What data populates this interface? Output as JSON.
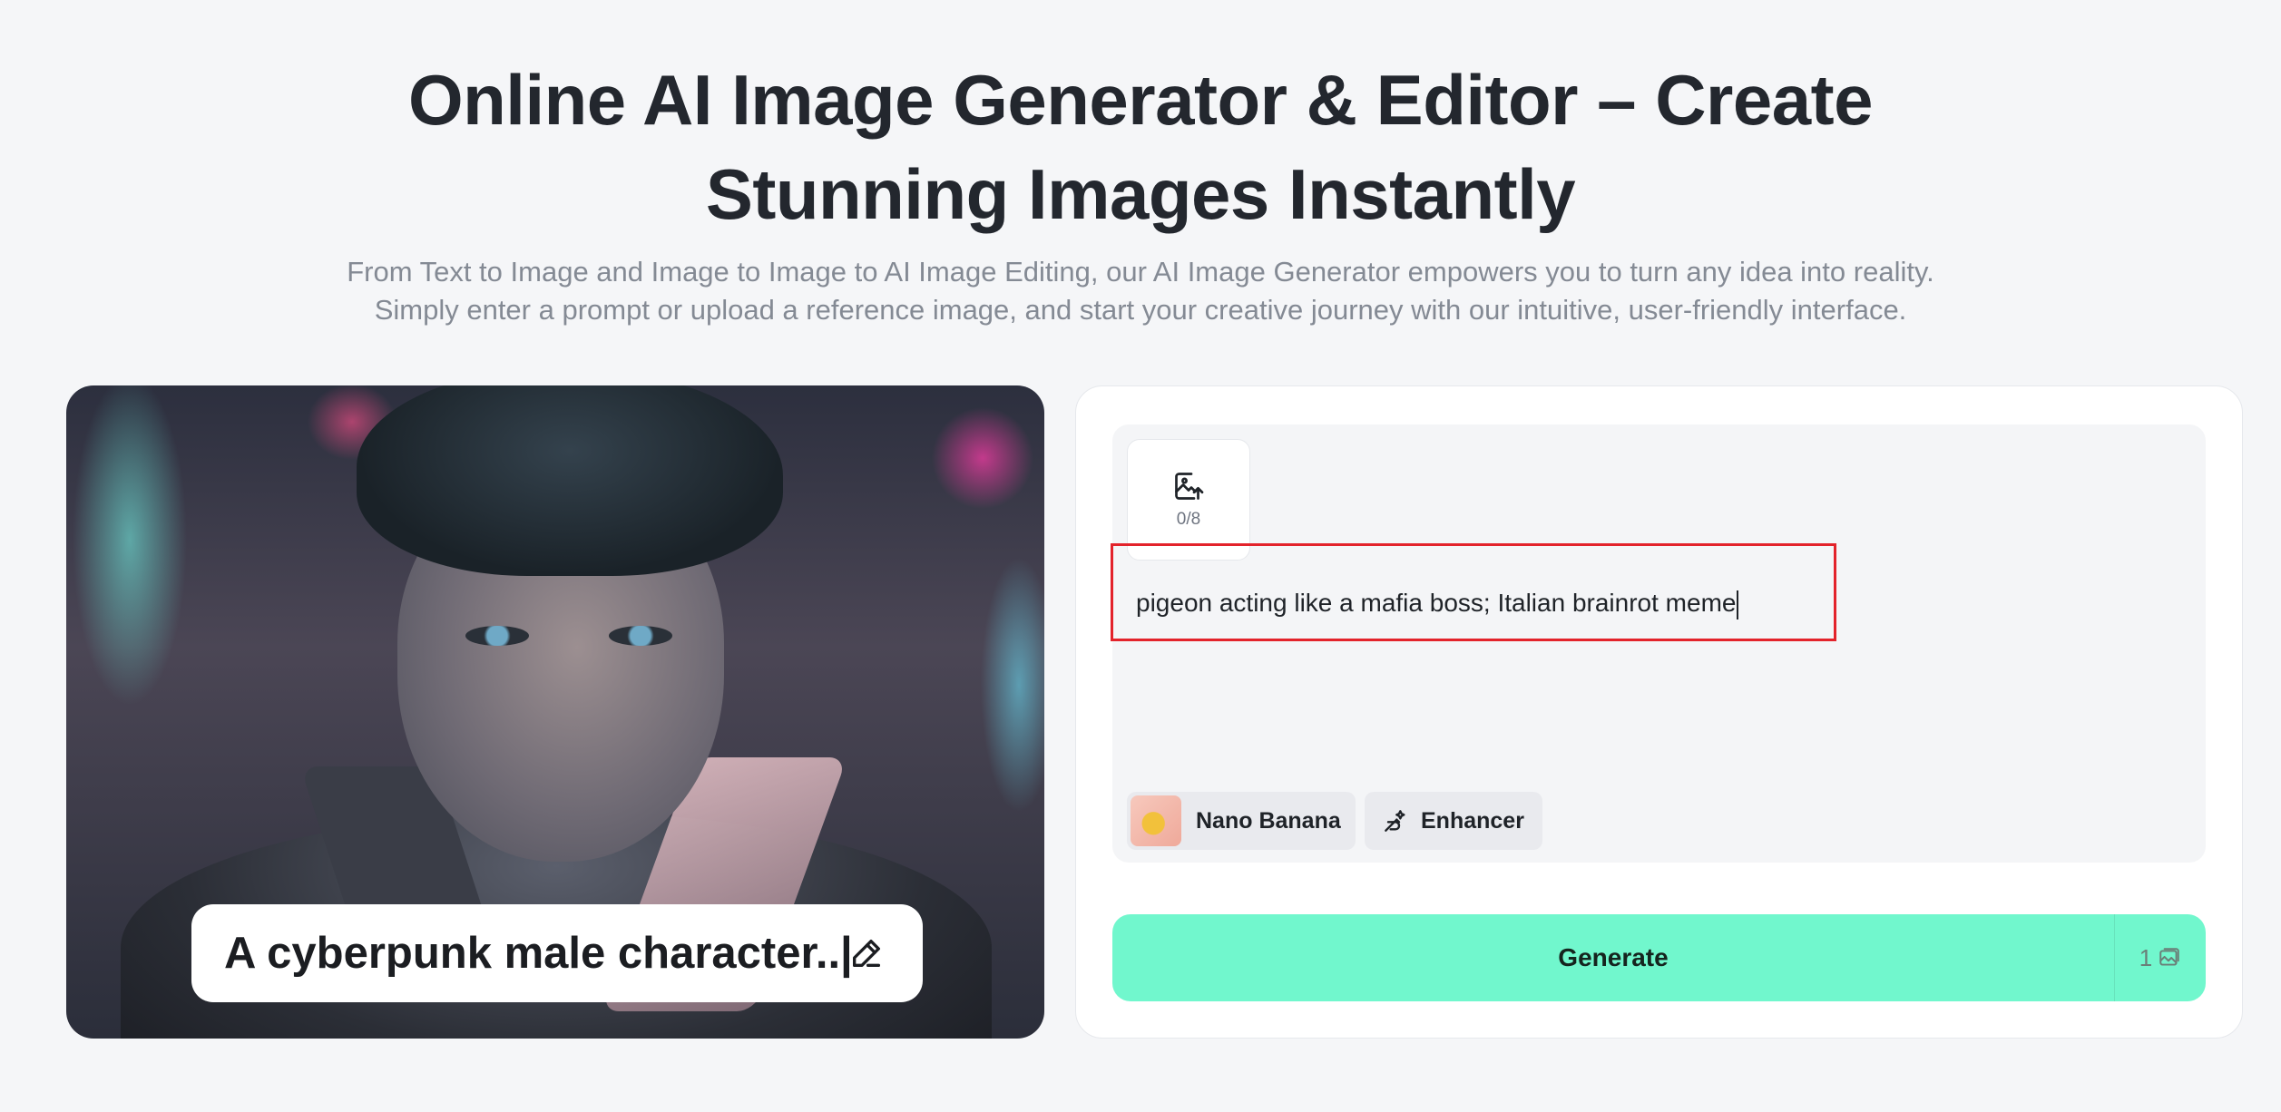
{
  "hero": {
    "title_line1": "Online AI Image Generator & Editor – Create",
    "title_line2": "Stunning Images Instantly",
    "subtitle_line1": "From Text to Image and Image to Image to AI Image Editing, our AI Image Generator empowers you to turn any idea into reality.",
    "subtitle_line2": "Simply enter a prompt or upload a reference image, and start your creative journey with our intuitive, user-friendly interface."
  },
  "showcase": {
    "caption": "A cyberpunk male character..|",
    "caption_icon": "pencil-edit-icon"
  },
  "panel": {
    "upload": {
      "icon": "image-upload-icon",
      "count": "0/8"
    },
    "prompt": {
      "value": "pigeon acting like a mafia boss; Italian brainrot meme"
    },
    "chips": {
      "model_label": "Nano Banana",
      "enhancer_label": "Enhancer",
      "enhancer_icon": "magic-wand-icon"
    },
    "generate": {
      "label": "Generate",
      "cost": "1",
      "cost_icon": "image-credit-icon"
    }
  },
  "colors": {
    "accent": "#71f7cd",
    "highlight": "#e3232b",
    "background": "#f5f6f8"
  }
}
